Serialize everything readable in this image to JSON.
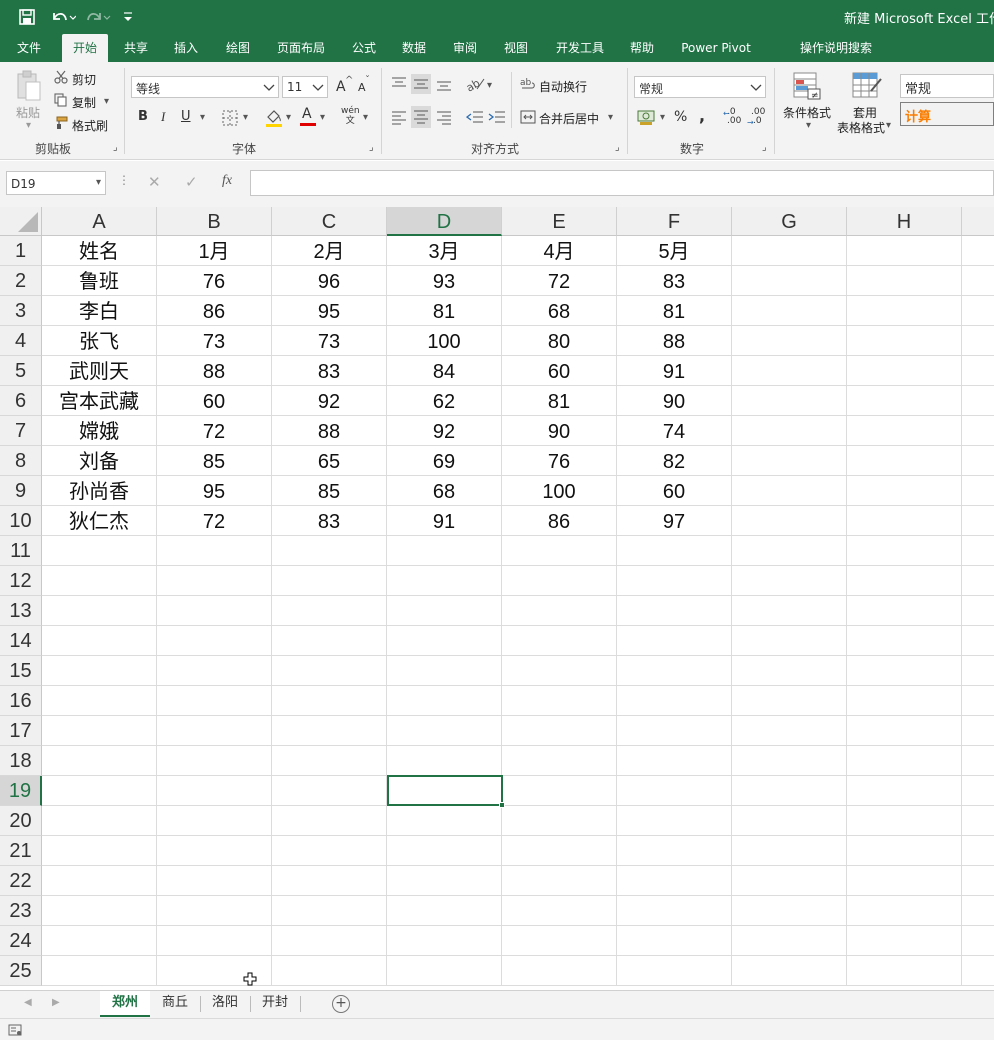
{
  "titlebar": {
    "title": "新建 Microsoft Excel 工作表",
    "save_icon": "save-icon",
    "undo_icon": "undo-icon",
    "redo_icon": "redo-icon",
    "customize_icon": "chevron-down-icon"
  },
  "ribbon_tabs": [
    "文件",
    "开始",
    "共享",
    "插入",
    "绘图",
    "页面布局",
    "公式",
    "数据",
    "审阅",
    "视图",
    "开发工具",
    "帮助",
    "Power Pivot",
    "操作说明搜索"
  ],
  "active_ribbon_tab": "开始",
  "clipboard": {
    "paste": "粘贴",
    "cut": "剪切",
    "copy": "复制",
    "format_painter": "格式刷",
    "label": "剪贴板"
  },
  "font": {
    "name": "等线",
    "size": "11",
    "bold": "B",
    "italic": "I",
    "underline": "U",
    "label": "字体",
    "increase": "A",
    "decrease": "A",
    "font_color": "A",
    "phonetic": "wén\n文"
  },
  "alignment": {
    "wrap_text": "自动换行",
    "merge_center": "合并后居中",
    "label": "对齐方式"
  },
  "number": {
    "format": "常规",
    "percent": "%",
    "comma": ",",
    "label": "数字",
    "inc_decimal": ".00",
    "dec_decimal": ".0"
  },
  "styles": {
    "conditional_format": "条件格式",
    "table_format_1": "套用",
    "table_format_2": "表格格式",
    "style_normal": "常规",
    "style_calc": "计算"
  },
  "formula_bar": {
    "name_box": "D19",
    "cancel": "✕",
    "enter": "✓",
    "fx": "fx",
    "content": ""
  },
  "sheet": {
    "columns": [
      "A",
      "B",
      "C",
      "D",
      "E",
      "F",
      "G",
      "H"
    ],
    "selected_column": "D",
    "selected_row": 19,
    "rows": [
      [
        "姓名",
        "1月",
        "2月",
        "3月",
        "4月",
        "5月"
      ],
      [
        "鲁班",
        "76",
        "96",
        "93",
        "72",
        "83"
      ],
      [
        "李白",
        "86",
        "95",
        "81",
        "68",
        "81"
      ],
      [
        "张飞",
        "73",
        "73",
        "100",
        "80",
        "88"
      ],
      [
        "武则天",
        "88",
        "83",
        "84",
        "60",
        "91"
      ],
      [
        "宫本武藏",
        "60",
        "92",
        "62",
        "81",
        "90"
      ],
      [
        "嫦娥",
        "72",
        "88",
        "92",
        "90",
        "74"
      ],
      [
        "刘备",
        "85",
        "65",
        "69",
        "76",
        "82"
      ],
      [
        "孙尚香",
        "95",
        "85",
        "68",
        "100",
        "60"
      ],
      [
        "狄仁杰",
        "72",
        "83",
        "91",
        "86",
        "97"
      ]
    ],
    "row_numbers": [
      "1",
      "2",
      "3",
      "4",
      "5",
      "6",
      "7",
      "8",
      "9",
      "10",
      "11",
      "12",
      "13",
      "14",
      "15",
      "16",
      "17",
      "18",
      "19",
      "20",
      "21",
      "22",
      "23",
      "24",
      "25"
    ]
  },
  "sheet_tabs": [
    "郑州",
    "商丘",
    "洛阳",
    "开封"
  ],
  "active_sheet": "郑州",
  "add_sheet": "+",
  "colors": {
    "accent": "#217346",
    "ribbon_bg": "#f3f3f3",
    "header_bg": "#f0f0f0",
    "style_calc_text": "#fa7d00"
  }
}
